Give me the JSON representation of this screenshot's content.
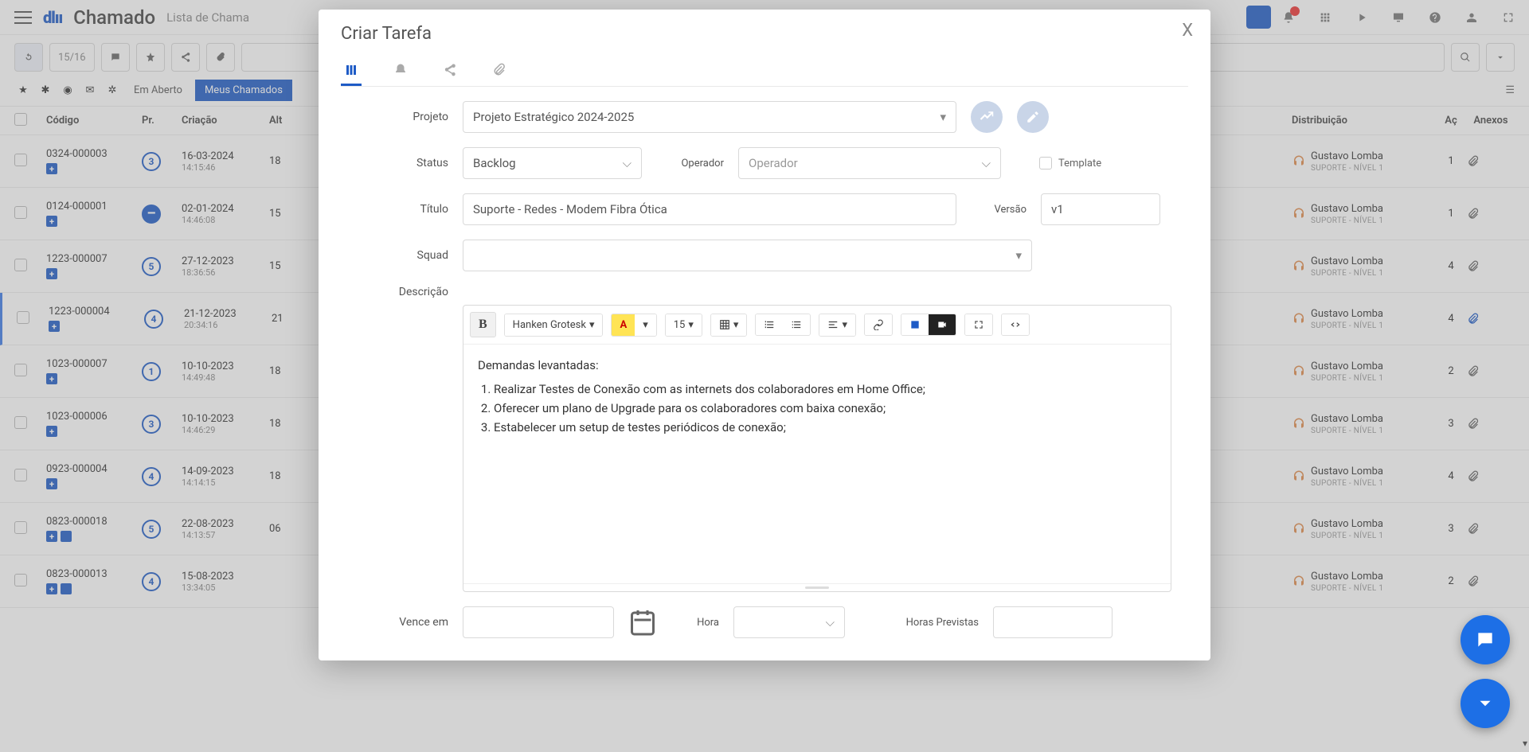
{
  "header": {
    "logo": "dlıı",
    "page_title": "Chamado",
    "breadcrumb": "Lista de Chama"
  },
  "toolbar": {
    "count": "15/16"
  },
  "filters": {
    "pill_open": "Em Aberto",
    "pill_mine": "Meus Chamados"
  },
  "columns": {
    "codigo": "Código",
    "pr": "Pr.",
    "criacao": "Criação",
    "alt": "Alt",
    "dist": "Distribuição",
    "acoes": "Aç",
    "anexos": "Anexos"
  },
  "rows": [
    {
      "codigo": "0324-000003",
      "pr": "3",
      "pr_style": "circle",
      "date": "16-03-2024",
      "time": "14:15:46",
      "alt": "18",
      "dist_name": "Gustavo Lomba",
      "dist_sub": "SUPORTE - NÍVEL 1",
      "acoes": "1",
      "clip": "grey",
      "extra": false,
      "selected": false
    },
    {
      "codigo": "0124-000001",
      "pr": "–",
      "pr_style": "minus",
      "date": "02-01-2024",
      "time": "14:46:08",
      "alt": "15",
      "dist_name": "Gustavo Lomba",
      "dist_sub": "SUPORTE - NÍVEL 1",
      "acoes": "1",
      "clip": "grey",
      "extra": false,
      "selected": false
    },
    {
      "codigo": "1223-000007",
      "pr": "5",
      "pr_style": "circle",
      "date": "27-12-2023",
      "time": "18:36:56",
      "alt": "15",
      "dist_name": "Gustavo Lomba",
      "dist_sub": "SUPORTE - NÍVEL 1",
      "acoes": "4",
      "clip": "grey",
      "extra": false,
      "selected": false
    },
    {
      "codigo": "1223-000004",
      "pr": "4",
      "pr_style": "circle",
      "date": "21-12-2023",
      "time": "20:34:16",
      "alt": "21",
      "dist_name": "Gustavo Lomba",
      "dist_sub": "SUPORTE - NÍVEL 1",
      "acoes": "4",
      "clip": "blue",
      "extra": false,
      "selected": true
    },
    {
      "codigo": "1023-000007",
      "pr": "1",
      "pr_style": "circle",
      "date": "10-10-2023",
      "time": "14:49:48",
      "alt": "18",
      "dist_name": "Gustavo Lomba",
      "dist_sub": "SUPORTE - NÍVEL 1",
      "acoes": "2",
      "clip": "grey",
      "extra": false,
      "selected": false
    },
    {
      "codigo": "1023-000006",
      "pr": "3",
      "pr_style": "circle",
      "date": "10-10-2023",
      "time": "14:46:29",
      "alt": "18",
      "dist_name": "Gustavo Lomba",
      "dist_sub": "SUPORTE - NÍVEL 1",
      "acoes": "3",
      "clip": "grey",
      "extra": false,
      "selected": false
    },
    {
      "codigo": "0923-000004",
      "pr": "4",
      "pr_style": "circle",
      "date": "14-09-2023",
      "time": "14:14:15",
      "alt": "18",
      "dist_name": "Gustavo Lomba",
      "dist_sub": "SUPORTE - NÍVEL 1",
      "acoes": "4",
      "clip": "grey",
      "extra": false,
      "selected": false
    },
    {
      "codigo": "0823-000018",
      "pr": "5",
      "pr_style": "circle",
      "date": "22-08-2023",
      "time": "14:13:57",
      "alt": "06",
      "dist_name": "Gustavo Lomba",
      "dist_sub": "SUPORTE - NÍVEL 1",
      "acoes": "3",
      "clip": "grey",
      "extra": true,
      "selected": false
    },
    {
      "codigo": "0823-000013",
      "pr": "4",
      "pr_style": "circle",
      "date": "15-08-2023",
      "time": "13:34:05",
      "alt": "",
      "dist_name": "Gustavo Lomba",
      "dist_sub": "SUPORTE - NÍVEL 1",
      "acoes": "2",
      "clip": "grey",
      "extra": true,
      "selected": false
    }
  ],
  "modal": {
    "title": "Criar Tarefa",
    "labels": {
      "projeto": "Projeto",
      "status": "Status",
      "operador": "Operador",
      "titulo": "Título",
      "versao": "Versão",
      "squad": "Squad",
      "descricao": "Descrição",
      "template": "Template",
      "vence_em": "Vence em",
      "hora": "Hora",
      "horas_previstas": "Horas Previstas"
    },
    "values": {
      "projeto": "Projeto Estratégico 2024-2025",
      "status": "Backlog",
      "operador": "Operador",
      "titulo": "Suporte - Redes - Modem Fibra Ótica",
      "versao": "v1",
      "squad": "",
      "vence_em": "",
      "hora": "",
      "horas_previstas": ""
    },
    "editor": {
      "font": "Hanken Grotesk",
      "size": "15",
      "heading": "Demandas levantadas:",
      "items": [
        "Realizar Testes de Conexão com as internets dos colaboradores em Home Office;",
        "Oferecer um plano de Upgrade para os colaboradores com baixa conexão;",
        "Estabelecer um setup de testes periódicos de conexão;"
      ]
    }
  }
}
